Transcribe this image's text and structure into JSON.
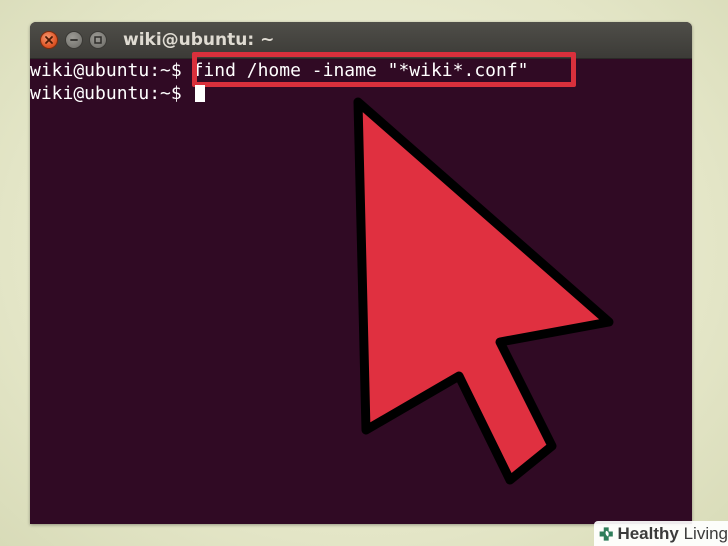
{
  "window": {
    "title": "wiki@ubuntu: ~",
    "buttons": {
      "close_icon": "close-icon",
      "minimize_icon": "minimize-icon",
      "maximize_icon": "maximize-icon"
    }
  },
  "terminal": {
    "lines": [
      {
        "prompt": "wiki@ubuntu:~$ ",
        "command": "find /home -iname \"*wiki*.conf\""
      },
      {
        "prompt": "wiki@ubuntu:~$ ",
        "command": ""
      }
    ],
    "colors": {
      "background": "#300a24",
      "text": "#ffffff"
    }
  },
  "annotation": {
    "highlight_color": "#d9303c",
    "arrow_color": "#e03040",
    "arrow_icon": "pointer-arrow-icon"
  },
  "watermark": {
    "bold": "Healthy",
    "light": " Living",
    "icon": "plus-leaf-icon"
  }
}
